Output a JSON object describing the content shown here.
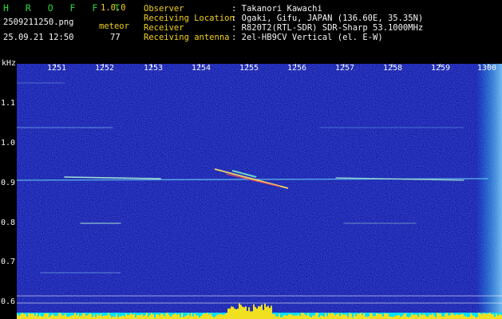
{
  "header": {
    "app_title": "H R O F F T",
    "app_version": "1.0.0",
    "filename": "2509211250.png",
    "meteor_label": "meteor",
    "datetime": "25.09.21 12:50",
    "meteor_count": "77",
    "info_labels": {
      "observer": "Observer",
      "location": "Receiving Location",
      "receiver": "Receiver",
      "antenna": "Receiving antenna"
    },
    "info_values": {
      "observer": ": Takanori Kawachi",
      "location": ": Ogaki, Gifu, JAPAN (136.60E, 35.35N)",
      "receiver": ": R820T2(RTL-SDR) SDR-Sharp 53.1000MHz",
      "antenna": ": 2el-HB9CV Vertical (el. E-W)"
    }
  },
  "axes": {
    "y_unit": "kHz",
    "y_ticks": [
      "1.1",
      "1.0",
      "0.9",
      "0.8",
      "0.7",
      "0.6"
    ],
    "x_ticks": [
      "1251",
      "1252",
      "1253",
      "1254",
      "1255",
      "1256",
      "1257",
      "1258",
      "1259",
      "1300"
    ]
  },
  "colors": {
    "background": "#000000",
    "spectrogram_base": "#1a1aa8",
    "title_green": "#2bd43b",
    "label_yellow": "#f2d21b",
    "text_white": "#f5f5f5",
    "signal_cyan": "#7fffd4",
    "bottom_band_yellow": "#f0e020",
    "bottom_band_cyan": "#00e0ff"
  }
}
